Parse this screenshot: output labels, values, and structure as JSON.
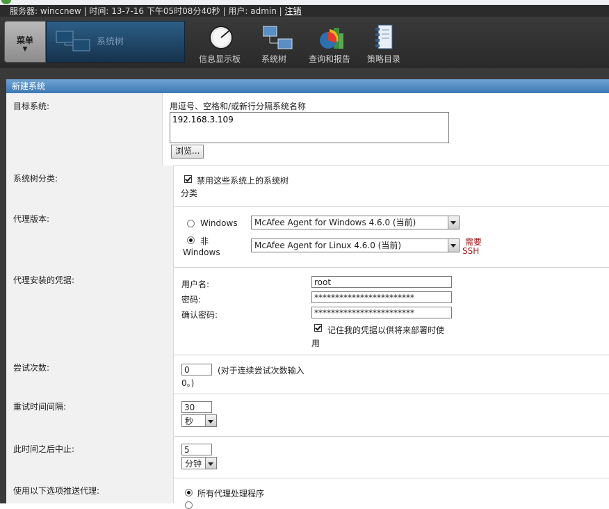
{
  "topbar": {
    "server_label": "服务器:",
    "server": "winccnew",
    "time_label": "时间:",
    "time": "13-7-16 下午05时08分40秒",
    "user_label": "用户:",
    "user": "admin",
    "logout": "注销"
  },
  "nav": {
    "menu_label": "菜单",
    "current_label": "系统树",
    "items": [
      {
        "label": "信息显示板",
        "icon": "dashboard-gauge-icon"
      },
      {
        "label": "系统树",
        "icon": "system-tree-icon"
      },
      {
        "label": "查询和报告",
        "icon": "query-report-icon"
      },
      {
        "label": "策略目录",
        "icon": "policy-catalog-icon"
      }
    ]
  },
  "section_title": "新建系统",
  "form": {
    "target": {
      "label": "目标系统:",
      "hint": "用逗号、空格和/或新行分隔系统名称",
      "value": "192.168.3.109",
      "browse": "浏览..."
    },
    "tree_sort": {
      "label": "系统树分类:",
      "checkbox_line1": "禁用这些系统上的系统树",
      "checkbox_line2": "分类",
      "checked": true
    },
    "agent_version": {
      "label": "代理版本:",
      "windows_label": "Windows",
      "nonwindows_line1": "非",
      "nonwindows_line2": "Windows",
      "windows_selected": false,
      "nonwindows_selected": true,
      "windows_value": "McAfee Agent for Windows 4.6.0 (当前)",
      "linux_value": "McAfee Agent for Linux 4.6.0 (当前)",
      "ssh_line1": "需要",
      "ssh_line2": "SSH"
    },
    "credentials": {
      "label": "代理安装的凭据:",
      "username_label": "用户名:",
      "username_value": "root",
      "password_label": "密码:",
      "password_value": "************************",
      "confirm_label": "确认密码:",
      "confirm_value": "************************",
      "remember_line1": "记住我的凭据以供将来部署时使",
      "remember_line2": "用",
      "remember_checked": true
    },
    "attempts": {
      "label": "尝试次数:",
      "value": "0",
      "hint_line1": "(对于连续尝试次数输入",
      "hint_line2": "0。)"
    },
    "retry_interval": {
      "label": "重试时间间隔:",
      "value": "30",
      "unit": "秒"
    },
    "abort_after": {
      "label": "此时间之后中止:",
      "value": "5",
      "unit": "分钟"
    },
    "push_via": {
      "label": "使用以下选项推送代理:",
      "option1": "所有代理处理程序",
      "option1_selected": true
    }
  }
}
